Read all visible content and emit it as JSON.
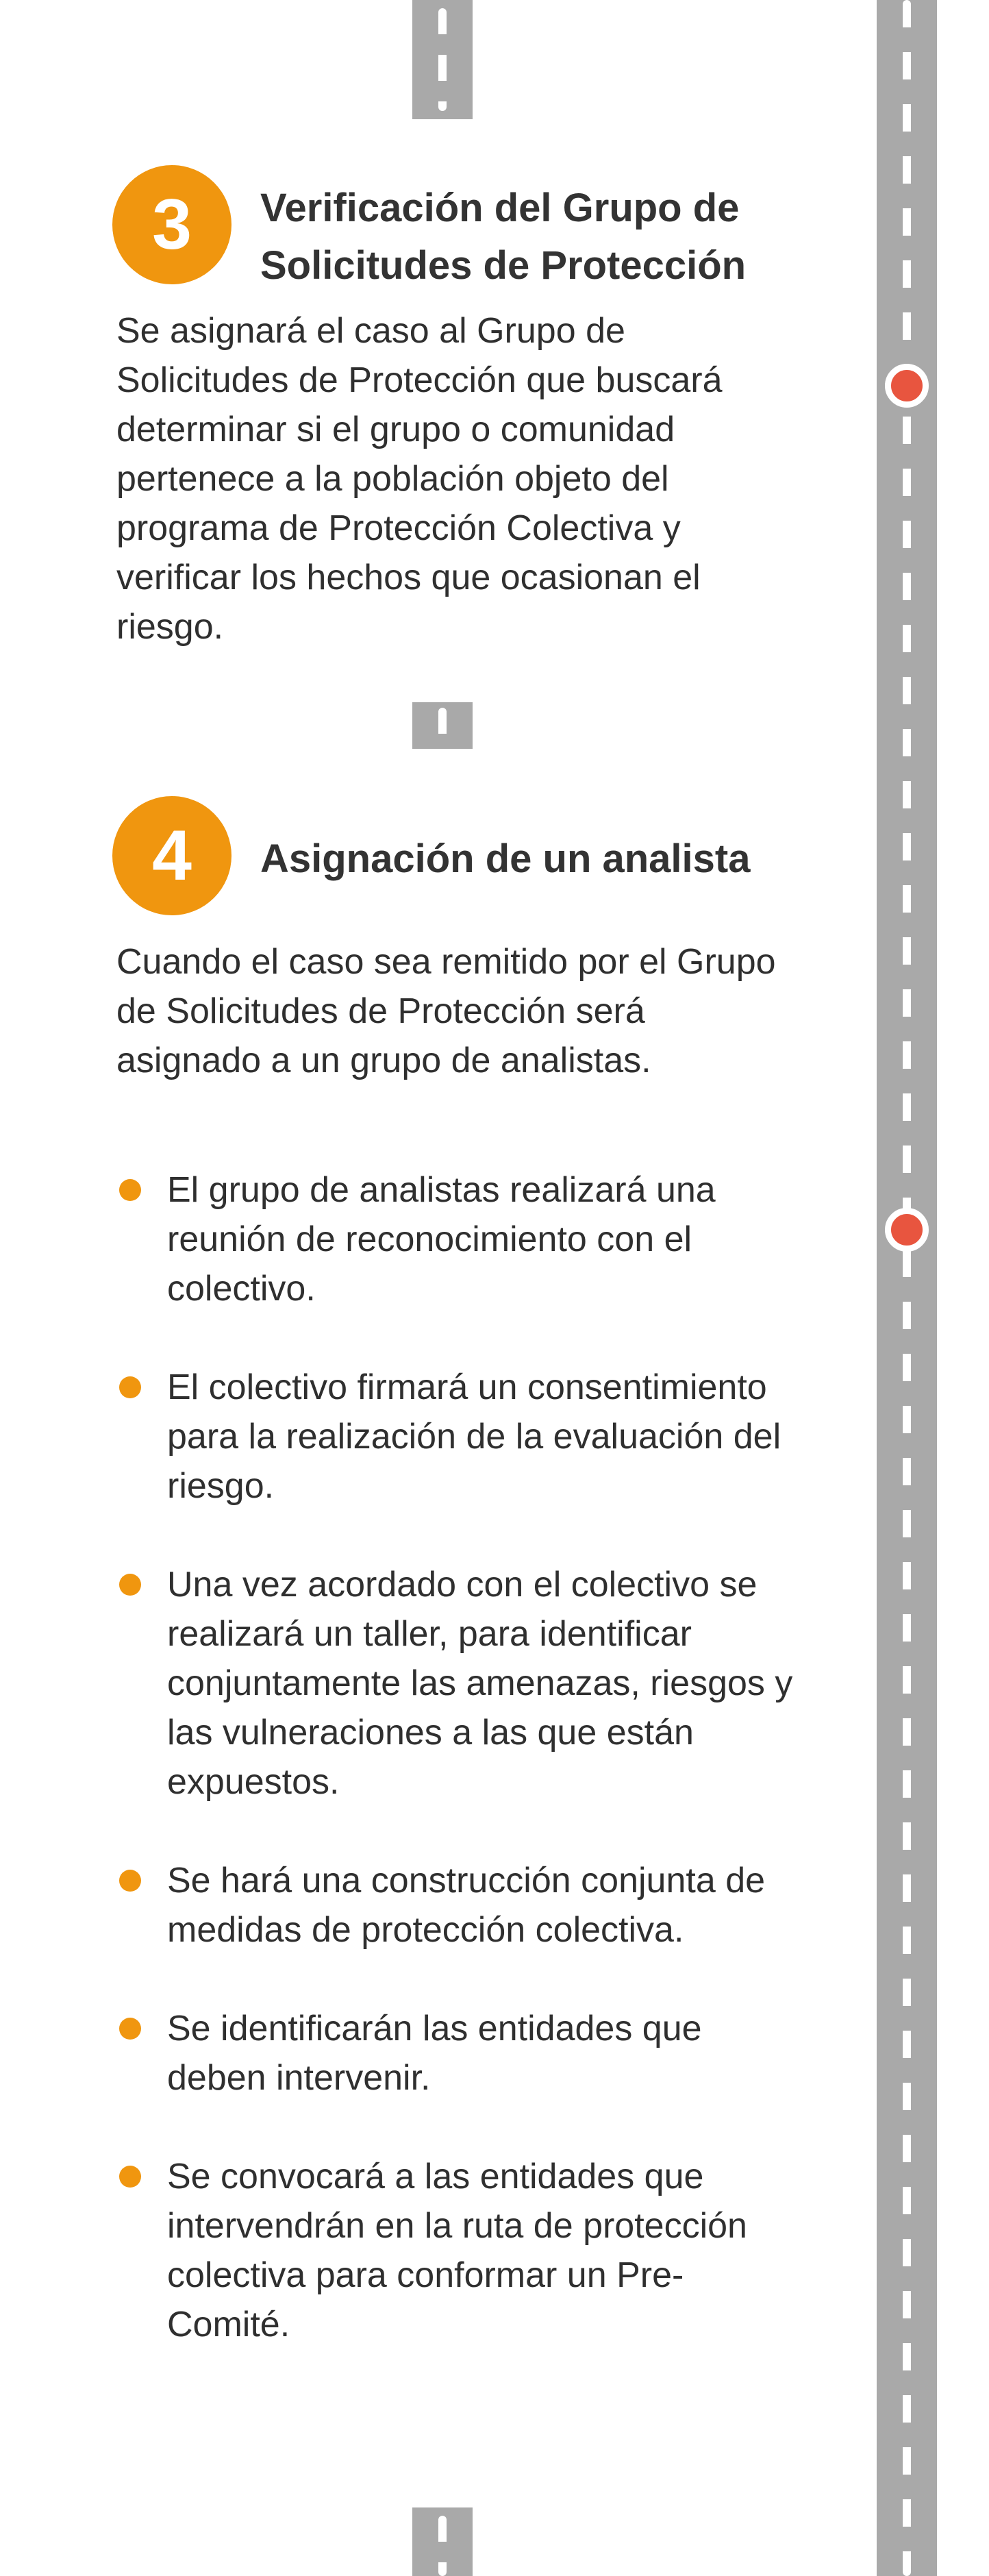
{
  "colors": {
    "accent_orange": "#f0960f",
    "road_gray": "#a9a9a9",
    "marker_red": "#e8553f",
    "text_dark": "#2f2f2f"
  },
  "step3": {
    "number": "3",
    "title": "Verificación del Grupo de Solicitudes de Protección",
    "body": "Se asignará el caso al Grupo de Solicitudes de Protección que buscará determinar si el grupo o comunidad pertenece a la población objeto del programa de Protección Colectiva y verificar los hechos que ocasionan el riesgo."
  },
  "step4": {
    "number": "4",
    "title": "Asignación de un analista",
    "body": "Cuando el caso sea remitido por el Grupo de Solicitudes de Protección será asignado a un grupo de analistas.",
    "bullets": [
      "El grupo de analistas realizará una reunión de reconocimiento con el colectivo.",
      "El colectivo firmará un consentimiento para la realización de la evaluación del riesgo.",
      "Una vez acordado con el colectivo se realizará un taller, para identificar conjuntamente las amenazas, riesgos y las vulneraciones a las que están expuestos.",
      "Se hará una construcción conjunta de medidas de protección colectiva.",
      "Se identificarán las entidades que deben intervenir.",
      "Se convocará a las entidades que intervendrán en la ruta de protección colectiva para conformar un Pre- Comité."
    ]
  }
}
